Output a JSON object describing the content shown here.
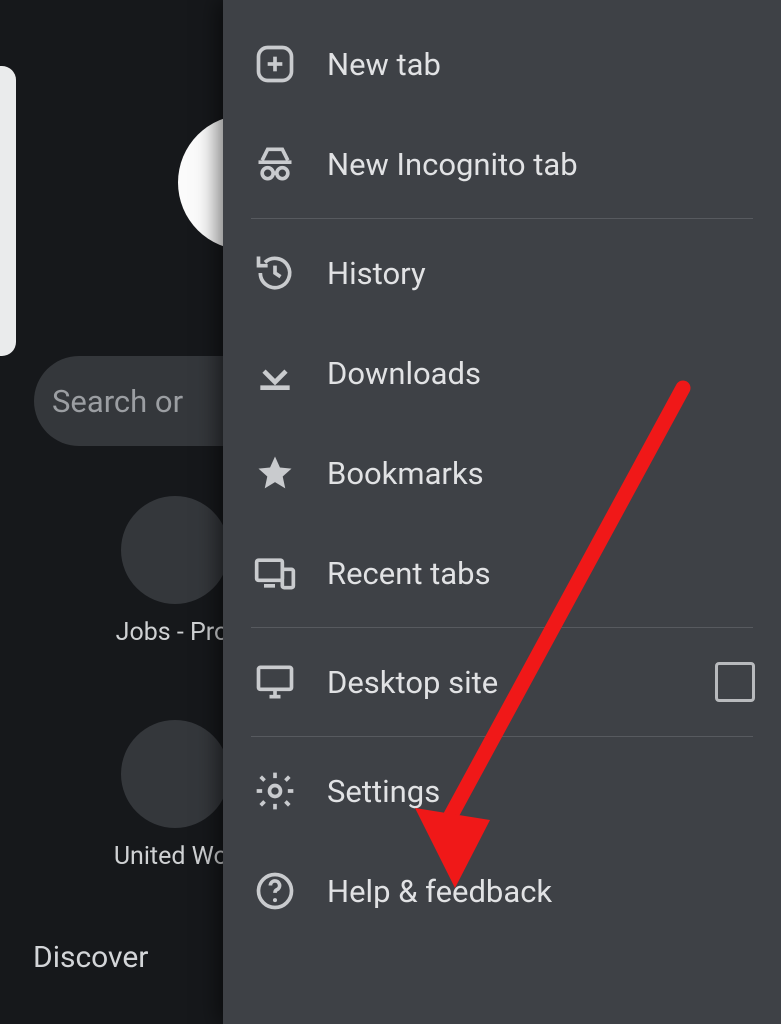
{
  "backdrop": {
    "search_placeholder": "Search or",
    "shortcut_1": "Jobs - Prol",
    "shortcut_2": "United Wor",
    "discover_label": "Discover"
  },
  "menu": {
    "new_tab": "New tab",
    "new_incognito": "New Incognito tab",
    "history": "History",
    "downloads": "Downloads",
    "bookmarks": "Bookmarks",
    "recent_tabs": "Recent tabs",
    "desktop_site": "Desktop site",
    "settings": "Settings",
    "help_feedback": "Help & feedback"
  },
  "annotation": {
    "arrow_color": "#f01818",
    "arrow_target": "settings"
  }
}
